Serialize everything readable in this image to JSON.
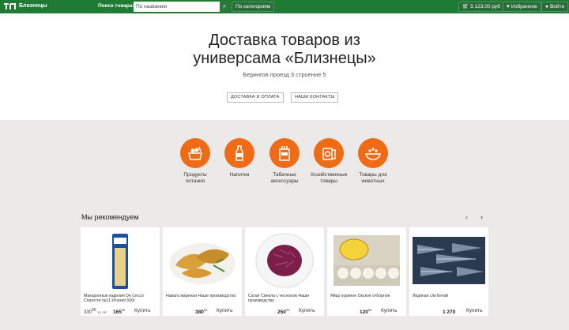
{
  "topbar": {
    "brand": "Близнецы",
    "search_label": "Поиск товара:",
    "search_placeholder": "По названию",
    "category_button": "По категориям",
    "cart_amount": "5 123.00 руб",
    "favorites": "Избранное",
    "login": "Войти"
  },
  "hero": {
    "title_line1": "Доставка товаров из",
    "title_line2": "универсама «Близнецы»",
    "address": "Берингов проезд 3 строение 5",
    "btn_delivery": "ДОСТАВКА И ОПЛАТА",
    "btn_contacts": "НАШИ КОНТАКТЫ"
  },
  "categories": [
    {
      "line1": "Продукты",
      "line2": "питания",
      "icon": "food-basket-icon"
    },
    {
      "line1": "Напитки",
      "line2": "",
      "icon": "bottle-icon"
    },
    {
      "line1": "Табачные",
      "line2": "аксессуары",
      "icon": "cigarettes-icon"
    },
    {
      "line1": "Хозяйственные",
      "line2": "товары",
      "icon": "paper-roll-icon"
    },
    {
      "line1": "Товары для",
      "line2": "животных",
      "icon": "pet-bowl-icon"
    }
  ],
  "recommend": {
    "title": "Мы рекомендуем",
    "prev": "‹",
    "next": "›"
  },
  "products": [
    {
      "name": "Макаронные изделия De Cecco Спагетти №11 Италия 500г",
      "old_price": "330",
      "old_cents": "00",
      "old_unit": "за 1кг",
      "price": "165",
      "cents": "00",
      "buy": "Купить"
    },
    {
      "name": "Навага жареная Наше производство",
      "old_price": "",
      "old_cents": "",
      "old_unit": "",
      "price": "380",
      "cents": "00",
      "buy": "Купить"
    },
    {
      "name": "Салат Свекла с чесноком Наше производство",
      "old_price": "",
      "old_cents": "",
      "old_unit": "",
      "price": "250",
      "cents": "00",
      "buy": "Купить"
    },
    {
      "name": "Яйцо куриное Окское отборное",
      "old_price": "",
      "old_cents": "",
      "old_unit": "",
      "price": "120",
      "cents": "00",
      "buy": "Купить"
    },
    {
      "name": "Ледяная с/м Китай",
      "old_price": "",
      "old_cents": "",
      "old_unit": "",
      "price": "1 270",
      "cents": "",
      "buy": "Купить"
    }
  ],
  "colors": {
    "green": "#1f7a34",
    "orange": "#ef6b15",
    "bg": "#ebeae8"
  }
}
